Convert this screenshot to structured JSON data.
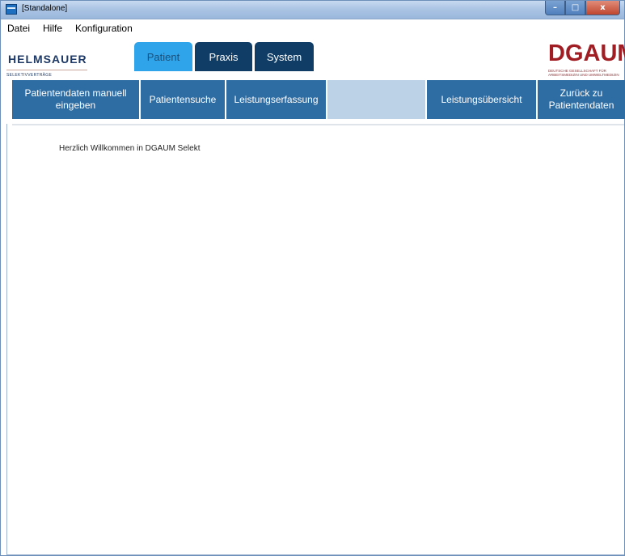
{
  "window": {
    "title": "[Standalone]"
  },
  "window_controls": {
    "minimize": "–",
    "maximize": "□",
    "close": "x"
  },
  "menu": [
    "Datei",
    "Hilfe",
    "Konfiguration"
  ],
  "brand_left": {
    "name": "HELMSAUER",
    "tagline": "SELEKTIVVERTRÄGE"
  },
  "brand_right": {
    "name": "DGAUM",
    "subtitle": "DEUTSCHE GESELLSCHAFT FÜR ARBEITSMEDIZIN UND UMWELTMEDIZIN"
  },
  "tabs": [
    {
      "label": "Patient",
      "active": true
    },
    {
      "label": "Praxis",
      "active": false
    },
    {
      "label": "System",
      "active": false
    }
  ],
  "toolbar": [
    {
      "label": "Patientendaten manuell eingeben"
    },
    {
      "label": "Patientensuche"
    },
    {
      "label": "Leistungserfassung"
    },
    {
      "label": ""
    },
    {
      "label": "Leistungsübersicht"
    },
    {
      "label": "Zurück zu Patientendaten"
    }
  ],
  "content": {
    "welcome": "Herzlich Willkommen in DGAUM Selekt"
  },
  "colors": {
    "tab_active": "#2fa4ea",
    "tab_inactive": "#0f3d66",
    "toolbar_button": "#2e6da4",
    "toolbar_blank": "#bcd2e6",
    "dgaum_red": "#a11d24",
    "helmsauer_blue": "#1f3a66"
  }
}
